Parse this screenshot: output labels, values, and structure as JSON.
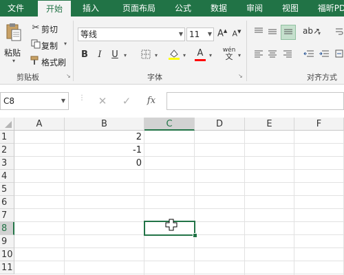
{
  "tabs": [
    {
      "label": "文件",
      "active": false
    },
    {
      "label": "开始",
      "active": true
    },
    {
      "label": "插入",
      "active": false
    },
    {
      "label": "页面布局",
      "active": false
    },
    {
      "label": "公式",
      "active": false
    },
    {
      "label": "数据",
      "active": false
    },
    {
      "label": "审阅",
      "active": false
    },
    {
      "label": "视图",
      "active": false
    },
    {
      "label": "福昕PD",
      "active": false
    }
  ],
  "clipboard": {
    "paste_label": "粘贴",
    "cut_label": "剪切",
    "copy_label": "复制",
    "format_painter_label": "格式刷",
    "group_label": "剪贴板"
  },
  "font": {
    "font_name": "等线",
    "font_size": "11",
    "bold": "B",
    "italic": "I",
    "underline": "U",
    "grow": "A",
    "shrink": "A",
    "font_color_glyph": "A",
    "phonetic": "wén",
    "phonetic_char": "文",
    "group_label": "字体",
    "highlight_color": "#ffff00",
    "font_color": "#ff0000"
  },
  "alignment": {
    "group_label": "对齐方式"
  },
  "formula_bar": {
    "name_box": "C8",
    "cancel": "✕",
    "enter": "✓",
    "fx": "fx",
    "value": ""
  },
  "grid": {
    "columns": [
      "A",
      "B",
      "C",
      "D",
      "E",
      "F"
    ],
    "selected_column": "C",
    "rows": [
      "1",
      "2",
      "3",
      "4",
      "5",
      "6",
      "7",
      "8",
      "9",
      "10",
      "11"
    ],
    "selected_row": "8",
    "cells": [
      {
        "ref": "B1",
        "value": "2"
      },
      {
        "ref": "B2",
        "value": "-1"
      },
      {
        "ref": "B3",
        "value": "0"
      }
    ],
    "active_cell": "C8"
  },
  "colors": {
    "accent": "#217346"
  }
}
